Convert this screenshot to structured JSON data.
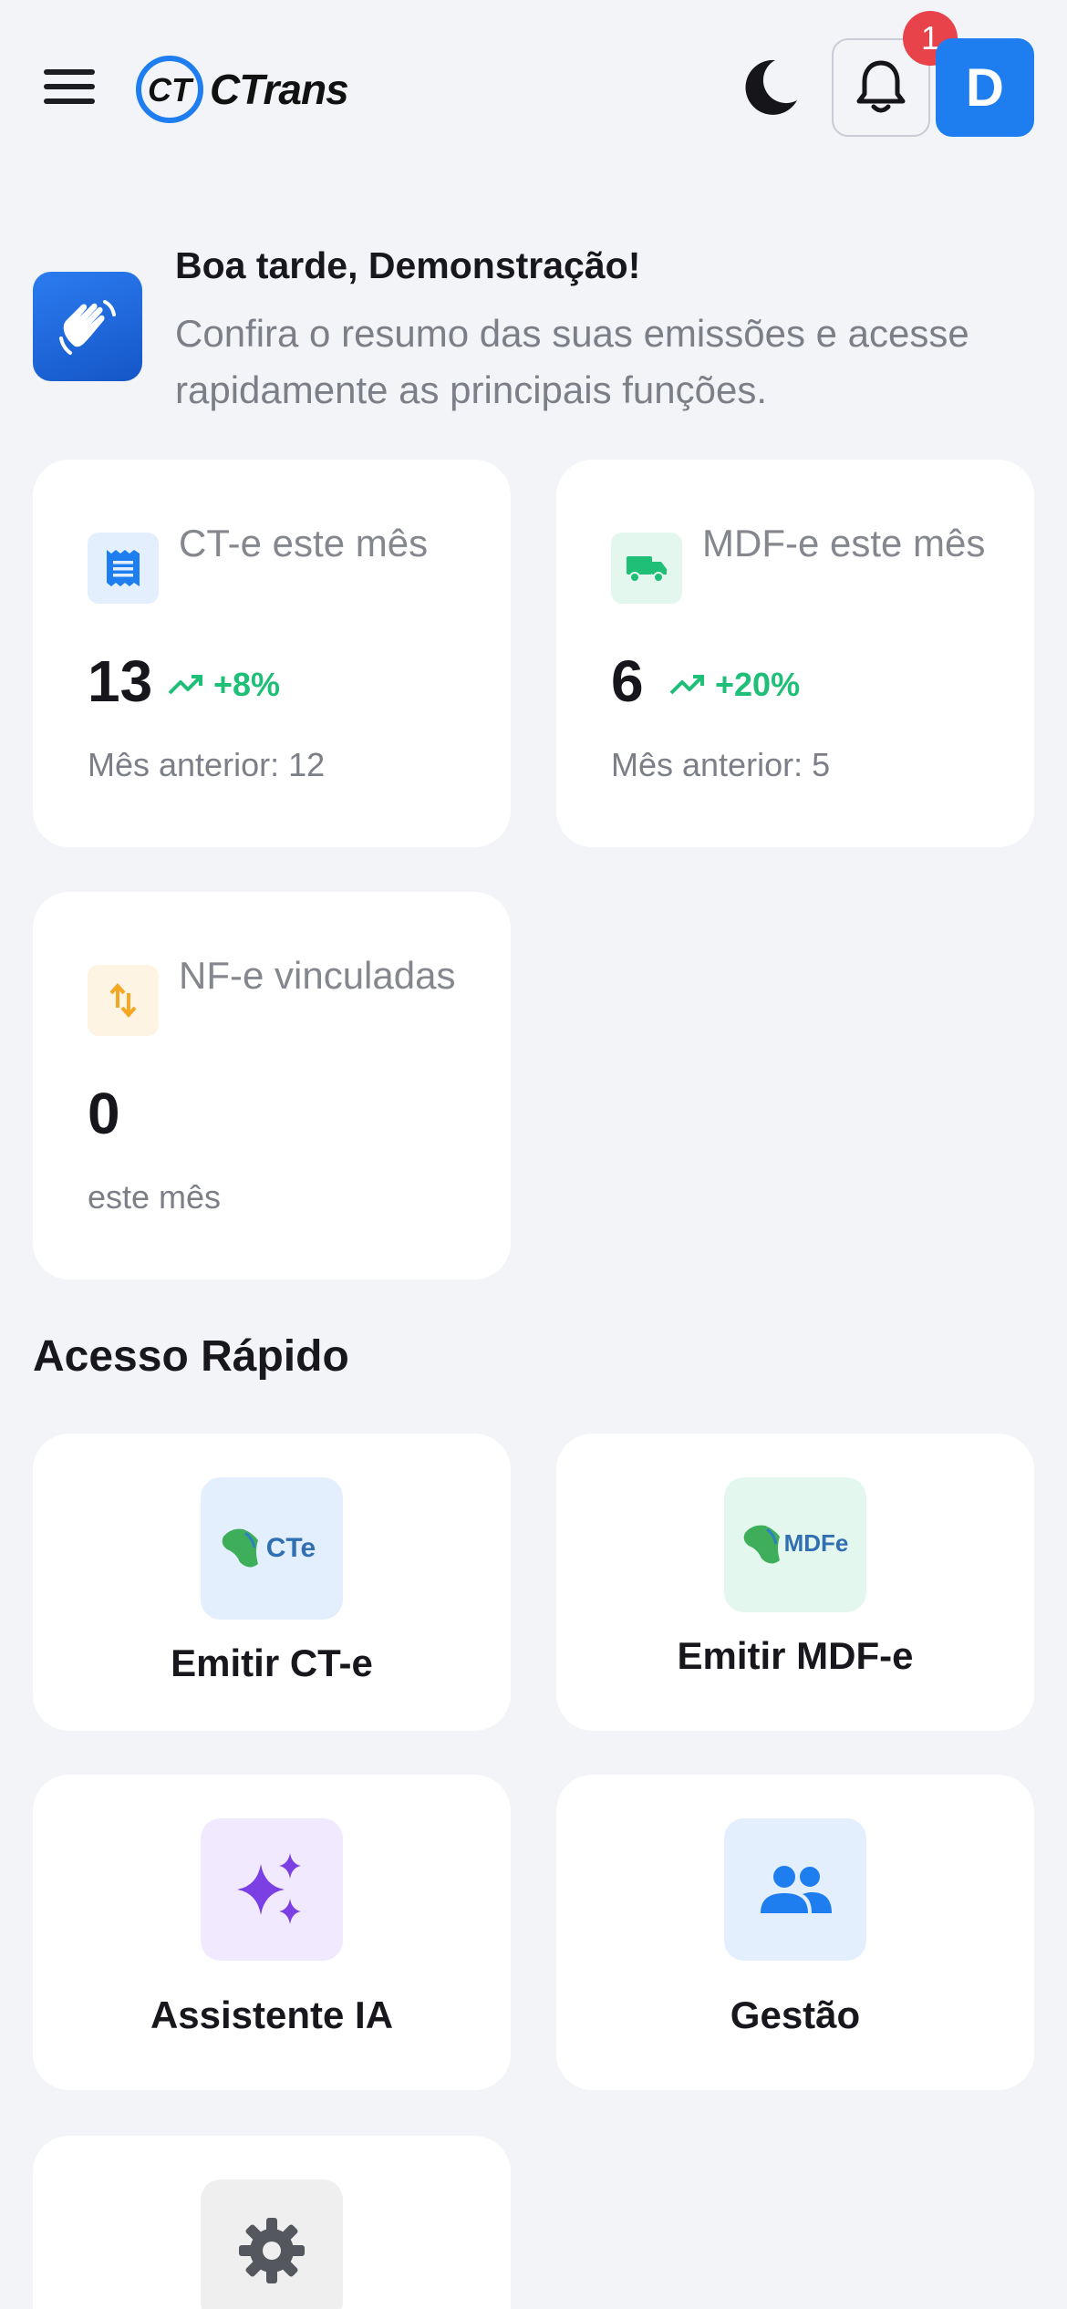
{
  "header": {
    "logo_text": "CTrans",
    "logo_mark": "CT",
    "notification_count": "1",
    "avatar_initial": "D"
  },
  "greeting": {
    "title": "Boa tarde, Demonstração!",
    "subtitle": "Confira o resumo das suas emissões e acesse rapidamente as principais funções."
  },
  "stats": [
    {
      "label": "CT-e este mês",
      "value": "13",
      "trend": "+8%",
      "footer": "Mês anterior: 12",
      "icon": "receipt-icon"
    },
    {
      "label": "MDF-e este mês",
      "value": "6",
      "trend": "+20%",
      "footer": "Mês anterior: 5",
      "icon": "truck-icon"
    },
    {
      "label": "NF-e vinculadas",
      "value": "0",
      "footer": "este mês",
      "icon": "swap-vertical-icon"
    }
  ],
  "quick_access": {
    "title": "Acesso Rápido",
    "items": [
      {
        "label": "Emitir CT-e",
        "icon": "cte-logo-icon",
        "icon_text": "CTe"
      },
      {
        "label": "Emitir MDF-e",
        "icon": "mdfe-logo-icon",
        "icon_text": "MDFe"
      },
      {
        "label": "Assistente IA",
        "icon": "sparkles-icon"
      },
      {
        "label": "Gestão",
        "icon": "people-icon"
      },
      {
        "label": "",
        "icon": "gear-icon"
      }
    ]
  },
  "colors": {
    "accent": "#1e7ef0",
    "positive": "#1fbf78",
    "badge": "#e8424a",
    "background": "#f3f4f8"
  }
}
